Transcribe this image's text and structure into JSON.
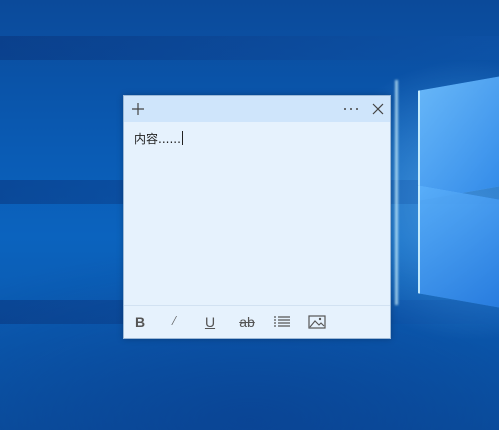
{
  "note": {
    "content": "内容......",
    "toolbar": {
      "bold": "B",
      "italic": "/",
      "underline": "U",
      "strikethrough": "ab"
    }
  },
  "icons": {
    "add": "plus-icon",
    "more": "ellipsis-icon",
    "close": "close-icon",
    "list": "list-icon",
    "image": "image-icon"
  },
  "colors": {
    "note_background": "#e6f2fd",
    "note_header": "#cfe5fb",
    "desktop_blue": "#0a5bb4"
  }
}
